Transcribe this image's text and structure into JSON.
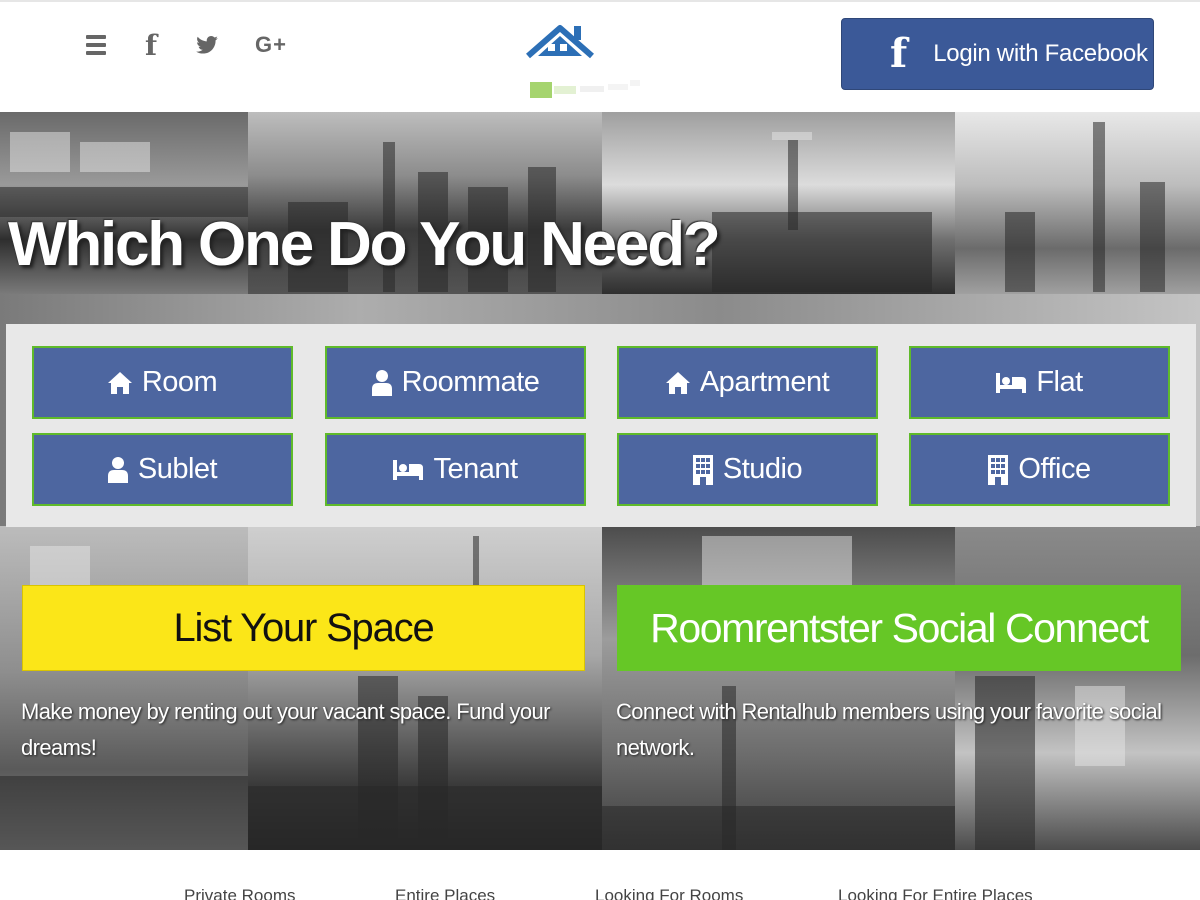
{
  "header": {
    "icons": [
      "menu-icon",
      "facebook-icon",
      "twitter-icon",
      "google-plus-icon"
    ],
    "google_plus_glyph": "G+",
    "facebook_glyph": "f",
    "login_button": {
      "label": "Login with Facebook",
      "icon": "facebook-icon",
      "color": "#3b5998"
    }
  },
  "hero": {
    "title": "Which One Do You Need?",
    "categories": [
      {
        "label": "Room",
        "icon": "home-icon"
      },
      {
        "label": "Roommate",
        "icon": "user-icon"
      },
      {
        "label": "Apartment",
        "icon": "home-icon"
      },
      {
        "label": "Flat",
        "icon": "bed-icon"
      },
      {
        "label": "Sublet",
        "icon": "user-icon"
      },
      {
        "label": "Tenant",
        "icon": "bed-icon"
      },
      {
        "label": "Studio",
        "icon": "building-icon"
      },
      {
        "label": "Office",
        "icon": "building-icon"
      }
    ],
    "list_space": {
      "label": "List Your Space",
      "color": "#fbe618",
      "description": "Make money by renting out your vacant space. Fund your dreams!"
    },
    "social_connect": {
      "label": "Roomrentster Social Connect",
      "color": "#66c726",
      "description": "Connect with Rentalhub members using your favorite social network."
    }
  },
  "colors": {
    "category_button": "#4d66a0",
    "category_border": "#5fba2a"
  },
  "footer_nav": [
    "Private Rooms",
    "Entire Places",
    "Looking For Rooms",
    "Looking For Entire Places"
  ]
}
